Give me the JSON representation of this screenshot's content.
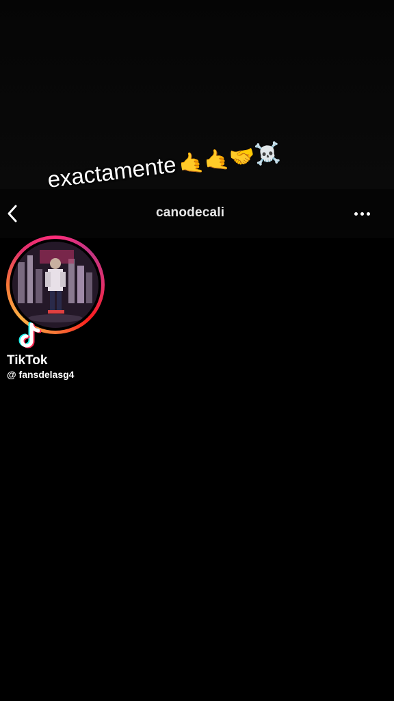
{
  "header": {
    "username": "canodecali"
  },
  "caption": {
    "text": "exactamente",
    "emojis": "🤙🤙🤝☠️"
  },
  "watermark": {
    "brand": "TikTok",
    "handle": "@ fansdelasg4"
  },
  "icons": {
    "back": "chevron-left-icon",
    "more": "more-horizontal-icon",
    "tiktok": "tiktok-logo-icon"
  },
  "colors": {
    "background": "#000000",
    "story_ring": [
      "#ff2d7a",
      "#fd1d1d",
      "#f77737",
      "#fcaf45"
    ],
    "text": "#ffffff"
  }
}
